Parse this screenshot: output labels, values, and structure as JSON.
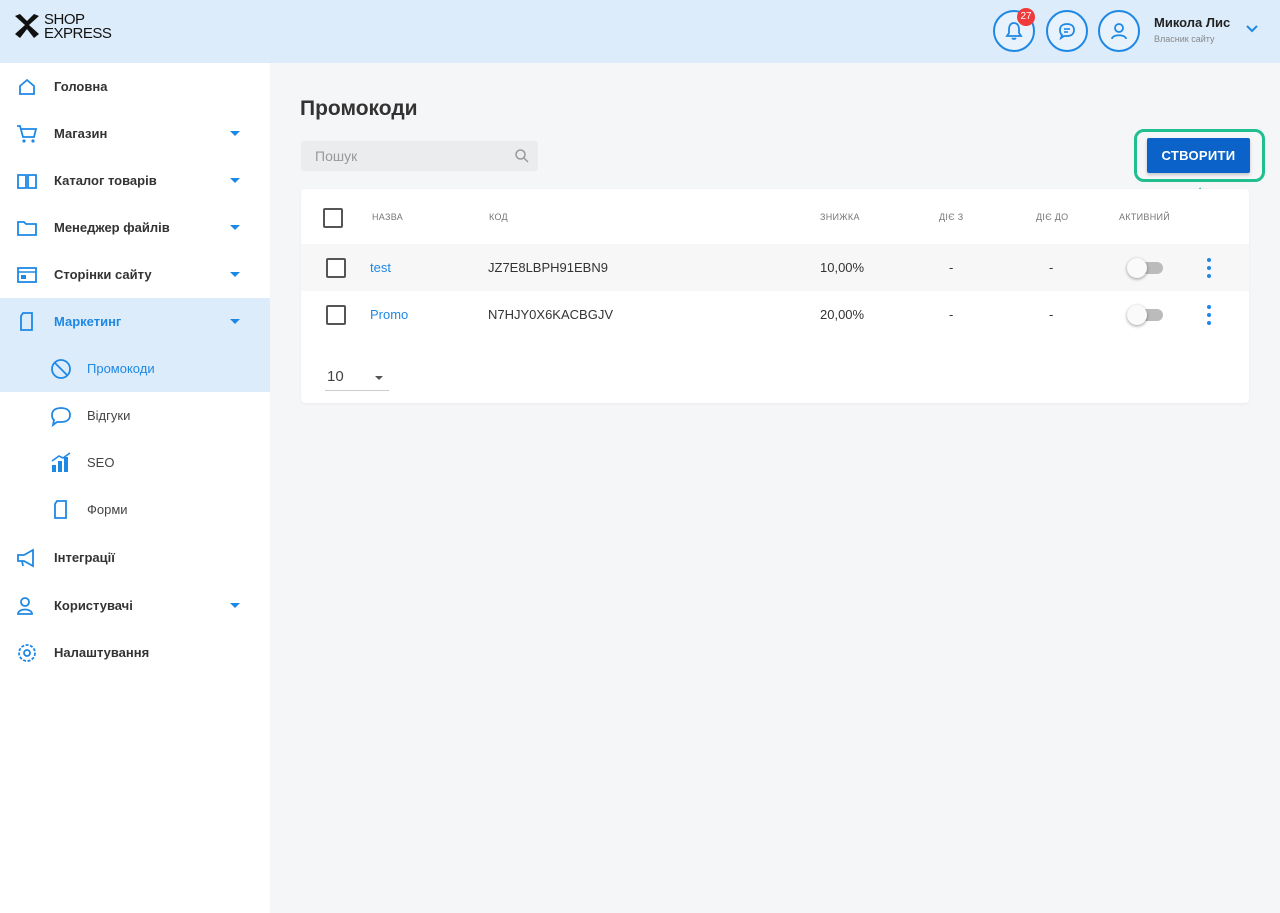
{
  "header": {
    "logo_line1": "SHOP",
    "logo_line2": "EXPRESS",
    "notifications_count": "27",
    "user_name": "Микола Лис",
    "user_role": "Власник сайту"
  },
  "sidebar": {
    "items": [
      {
        "label": "Головна",
        "icon": "home-icon"
      },
      {
        "label": "Магазин",
        "icon": "cart-icon"
      },
      {
        "label": "Каталог товарів",
        "icon": "catalog-icon"
      },
      {
        "label": "Менеджер файлів",
        "icon": "folder-icon"
      },
      {
        "label": "Сторінки сайту",
        "icon": "pages-icon"
      },
      {
        "label": "Маркетинг",
        "icon": "marketing-icon"
      },
      {
        "label": "Інтеграції",
        "icon": "megaphone-icon"
      },
      {
        "label": "Користувачі",
        "icon": "users-icon"
      },
      {
        "label": "Налаштування",
        "icon": "gear-icon"
      }
    ],
    "sub_items": [
      {
        "label": "Промокоди",
        "icon": "promo-icon"
      },
      {
        "label": "Відгуки",
        "icon": "chat-icon"
      },
      {
        "label": "SEO",
        "icon": "chart-icon"
      },
      {
        "label": "Форми",
        "icon": "form-icon"
      }
    ]
  },
  "main": {
    "title": "Промокоди",
    "search_placeholder": "Пошук",
    "create_label": "СТВОРИТИ",
    "columns": [
      "Назва",
      "Код",
      "Знижка",
      "Діє з",
      "Діє до",
      "Активний"
    ],
    "rows": [
      {
        "name": "test",
        "code": "JZ7E8LBPH91EBN9",
        "discount": "10,00%",
        "from": "-",
        "to": "-",
        "active": false
      },
      {
        "name": "Promo",
        "code": "N7HJY0X6KACBGJV",
        "discount": "20,00%",
        "from": "-",
        "to": "-",
        "active": false
      }
    ],
    "per_page": "10"
  },
  "colors": {
    "accent": "#1e88e5",
    "button": "#0b63c9",
    "highlight": "#1fbf8f",
    "header_bg": "#dcecfa",
    "badge": "#ef3b3b"
  }
}
